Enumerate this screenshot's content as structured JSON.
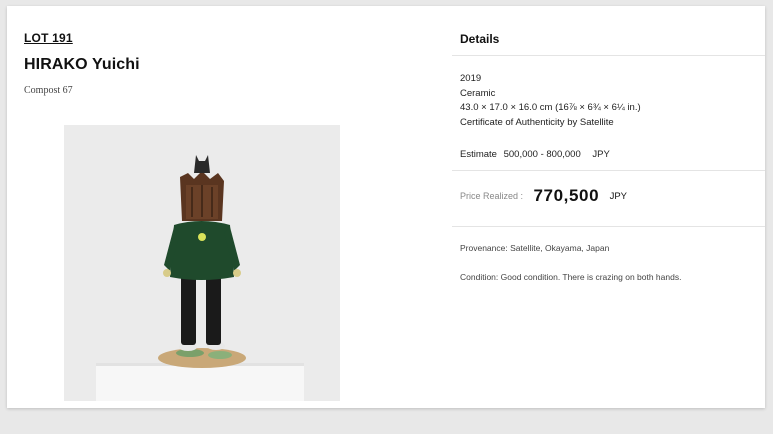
{
  "lot": {
    "number_label": "LOT 191",
    "artist": "HIRAKO Yuichi",
    "title": "Compost 67"
  },
  "artwork_image": {
    "description_icon": "sculpture-photo",
    "colors": {
      "background": "#ebebeb",
      "pedestal": "#f7f7f7",
      "jacket": "#1f4a2c",
      "pants": "#1a1a1a",
      "head": "#5a3520",
      "base": "#c9a878"
    }
  },
  "details": {
    "heading": "Details",
    "year": "2019",
    "medium": "Ceramic",
    "dimensions": "43.0 × 17.0 × 16.0 cm (16⅞ × 6¾ × 6¼ in.)",
    "certificate": "Certificate of Authenticity by Satellite",
    "estimate_label": "Estimate",
    "estimate_value": "500,000 - 800,000",
    "estimate_currency": "JPY",
    "price_label": "Price Realized :",
    "price_value": "770,500",
    "price_currency": "JPY",
    "provenance": "Provenance: Satellite, Okayama, Japan",
    "condition": "Condition: Good condition. There is crazing on both hands."
  }
}
